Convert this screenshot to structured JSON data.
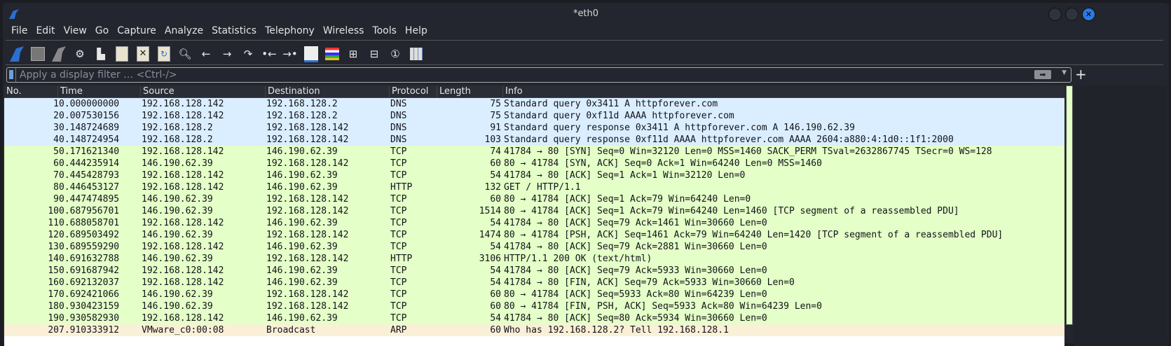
{
  "window": {
    "title": "*eth0"
  },
  "menu": [
    "File",
    "Edit",
    "View",
    "Go",
    "Capture",
    "Analyze",
    "Statistics",
    "Telephony",
    "Wireless",
    "Tools",
    "Help"
  ],
  "filter": {
    "placeholder": "Apply a display filter … <Ctrl-/>"
  },
  "columns": [
    "No.",
    "Time",
    "Source",
    "Destination",
    "Protocol",
    "Length",
    "Info"
  ],
  "colors": {
    "DNS": "#daeeff",
    "TCP": "#e4ffc7",
    "HTTP": "#e4ffc7",
    "ARP": "#faf0d7"
  },
  "packets": [
    [
      "1",
      "0.000000000",
      "192.168.128.142",
      "192.168.128.2",
      "DNS",
      "75",
      "Standard query 0x3411 A httpforever.com"
    ],
    [
      "2",
      "0.007530156",
      "192.168.128.142",
      "192.168.128.2",
      "DNS",
      "75",
      "Standard query 0xf11d AAAA httpforever.com"
    ],
    [
      "3",
      "0.148724689",
      "192.168.128.2",
      "192.168.128.142",
      "DNS",
      "91",
      "Standard query response 0x3411 A httpforever.com A 146.190.62.39"
    ],
    [
      "4",
      "0.148724954",
      "192.168.128.2",
      "192.168.128.142",
      "DNS",
      "103",
      "Standard query response 0xf11d AAAA httpforever.com AAAA 2604:a880:4:1d0::1f1:2000"
    ],
    [
      "5",
      "0.171621340",
      "192.168.128.142",
      "146.190.62.39",
      "TCP",
      "74",
      "41784 → 80 [SYN] Seq=0 Win=32120 Len=0 MSS=1460 SACK_PERM TSval=2632867745 TSecr=0 WS=128"
    ],
    [
      "6",
      "0.444235914",
      "146.190.62.39",
      "192.168.128.142",
      "TCP",
      "60",
      "80 → 41784 [SYN, ACK] Seq=0 Ack=1 Win=64240 Len=0 MSS=1460"
    ],
    [
      "7",
      "0.445428793",
      "192.168.128.142",
      "146.190.62.39",
      "TCP",
      "54",
      "41784 → 80 [ACK] Seq=1 Ack=1 Win=32120 Len=0"
    ],
    [
      "8",
      "0.446453127",
      "192.168.128.142",
      "146.190.62.39",
      "HTTP",
      "132",
      "GET / HTTP/1.1"
    ],
    [
      "9",
      "0.447474895",
      "146.190.62.39",
      "192.168.128.142",
      "TCP",
      "60",
      "80 → 41784 [ACK] Seq=1 Ack=79 Win=64240 Len=0"
    ],
    [
      "10",
      "0.687956701",
      "146.190.62.39",
      "192.168.128.142",
      "TCP",
      "1514",
      "80 → 41784 [ACK] Seq=1 Ack=79 Win=64240 Len=1460 [TCP segment of a reassembled PDU]"
    ],
    [
      "11",
      "0.688058701",
      "192.168.128.142",
      "146.190.62.39",
      "TCP",
      "54",
      "41784 → 80 [ACK] Seq=79 Ack=1461 Win=30660 Len=0"
    ],
    [
      "12",
      "0.689503492",
      "146.190.62.39",
      "192.168.128.142",
      "TCP",
      "1474",
      "80 → 41784 [PSH, ACK] Seq=1461 Ack=79 Win=64240 Len=1420 [TCP segment of a reassembled PDU]"
    ],
    [
      "13",
      "0.689559290",
      "192.168.128.142",
      "146.190.62.39",
      "TCP",
      "54",
      "41784 → 80 [ACK] Seq=79 Ack=2881 Win=30660 Len=0"
    ],
    [
      "14",
      "0.691632788",
      "146.190.62.39",
      "192.168.128.142",
      "HTTP",
      "3106",
      "HTTP/1.1 200 OK  (text/html)"
    ],
    [
      "15",
      "0.691687942",
      "192.168.128.142",
      "146.190.62.39",
      "TCP",
      "54",
      "41784 → 80 [ACK] Seq=79 Ack=5933 Win=30660 Len=0"
    ],
    [
      "16",
      "0.692132037",
      "192.168.128.142",
      "146.190.62.39",
      "TCP",
      "54",
      "41784 → 80 [FIN, ACK] Seq=79 Ack=5933 Win=30660 Len=0"
    ],
    [
      "17",
      "0.692421066",
      "146.190.62.39",
      "192.168.128.142",
      "TCP",
      "60",
      "80 → 41784 [ACK] Seq=5933 Ack=80 Win=64239 Len=0"
    ],
    [
      "18",
      "0.930423159",
      "146.190.62.39",
      "192.168.128.142",
      "TCP",
      "60",
      "80 → 41784 [FIN, PSH, ACK] Seq=5933 Ack=80 Win=64239 Len=0"
    ],
    [
      "19",
      "0.930582930",
      "192.168.128.142",
      "146.190.62.39",
      "TCP",
      "54",
      "41784 → 80 [ACK] Seq=80 Ack=5934 Win=30660 Len=0"
    ],
    [
      "20",
      "7.910333912",
      "VMware_c0:00:08",
      "Broadcast",
      "ARP",
      "60",
      "Who has 192.168.128.2? Tell 192.168.128.1"
    ]
  ]
}
